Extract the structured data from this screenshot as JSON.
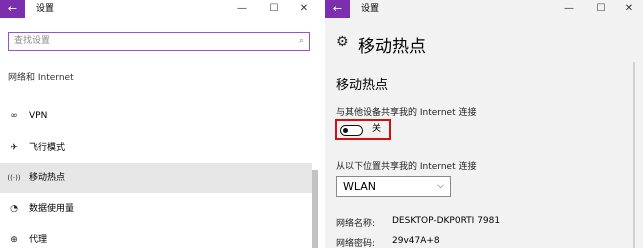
{
  "left_window": {
    "title": "设置",
    "controls": {
      "back": "←",
      "minimize": "—",
      "maximize": "☐",
      "close": "✕"
    },
    "search": {
      "placeholder": "查找设置",
      "icon": "search-icon"
    },
    "section": "网络和 Internet",
    "nav_items": [
      {
        "label": "VPN",
        "icon": "vpn-icon",
        "glyph": "∞",
        "selected": false
      },
      {
        "label": "飞行模式",
        "icon": "airplane-icon",
        "glyph": "✈",
        "selected": false
      },
      {
        "label": "移动热点",
        "icon": "hotspot-icon",
        "glyph": "((·))",
        "selected": true
      },
      {
        "label": "数据使用量",
        "icon": "data-usage-icon",
        "glyph": "◔",
        "selected": false
      },
      {
        "label": "代理",
        "icon": "proxy-icon",
        "glyph": "⊕",
        "selected": false
      }
    ]
  },
  "right_window": {
    "title": "设置",
    "controls": {
      "back": "←",
      "minimize": "—",
      "maximize": "☐",
      "close": "✕"
    },
    "page_title": "移动热点",
    "gear_glyph": "⚙",
    "sub_title": "移动热点",
    "share_label": "与其他设备共享我的 Internet 连接",
    "toggle": {
      "state": "off",
      "label": "关"
    },
    "from_label": "从以下位置共享我的 Internet 连接",
    "connection_select": {
      "value": "WLAN",
      "chevron": "⌵"
    },
    "network_name": {
      "label": "网络名称:",
      "value": "DESKTOP-DKP0RTI 7981"
    },
    "network_password": {
      "label": "网络密码:",
      "value": "29v47A+8"
    }
  }
}
